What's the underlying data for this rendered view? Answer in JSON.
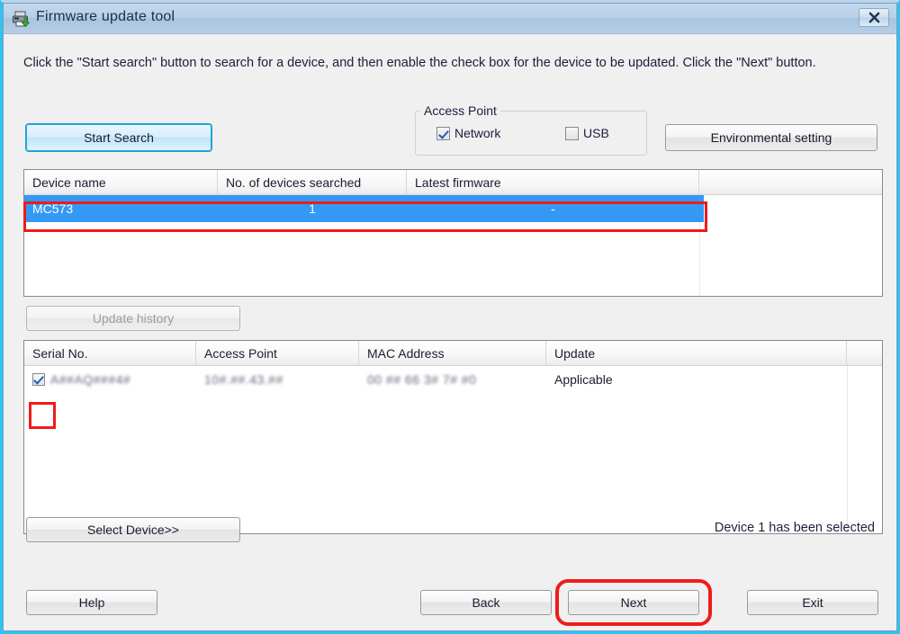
{
  "window": {
    "title": "Firmware update tool",
    "icon": "printer-download-icon",
    "close_label": "✖",
    "accent_border": "#2ec4ef",
    "titlebar_color": "#b8d0e8"
  },
  "instructions": "Click the \"Start search\" button to search for a device, and then enable the check box for the device to be updated. Click the \"Next\" button.",
  "toolbar": {
    "start_search_label": "Start Search",
    "environmental_setting_label": "Environmental setting"
  },
  "access_point": {
    "group_title": "Access Point",
    "options": [
      {
        "label": "Network",
        "checked": true
      },
      {
        "label": "USB",
        "checked": false
      }
    ]
  },
  "device_table": {
    "columns": [
      "Device name",
      "No. of devices searched",
      "Latest firmware",
      ""
    ],
    "rows": [
      {
        "device_name": "MC573",
        "devices_searched": "1",
        "latest_firmware": "-",
        "extra": "",
        "selected": true
      }
    ],
    "selection_color": "#3399f5"
  },
  "update_history": {
    "label": "Update history",
    "enabled": false
  },
  "serial_table": {
    "columns": [
      "Serial No.",
      "Access Point",
      "MAC Address",
      "Update",
      ""
    ],
    "rows": [
      {
        "checked": true,
        "serial_no": "A##AQ###4#",
        "access_point": "10#.##.43.##",
        "mac_address": "00 ## 66 3# 7# #0",
        "update": "Applicable",
        "extra": ""
      }
    ]
  },
  "select_device": {
    "label": "Select Device>>"
  },
  "status": {
    "text": "Device 1 has been selected"
  },
  "footer": {
    "help_label": "Help",
    "back_label": "Back",
    "next_label": "Next",
    "exit_label": "Exit"
  },
  "annotations": {
    "color": "#ee1c1c",
    "items": [
      "device-row-highlight",
      "row-checkbox-highlight",
      "next-button-highlight"
    ]
  }
}
